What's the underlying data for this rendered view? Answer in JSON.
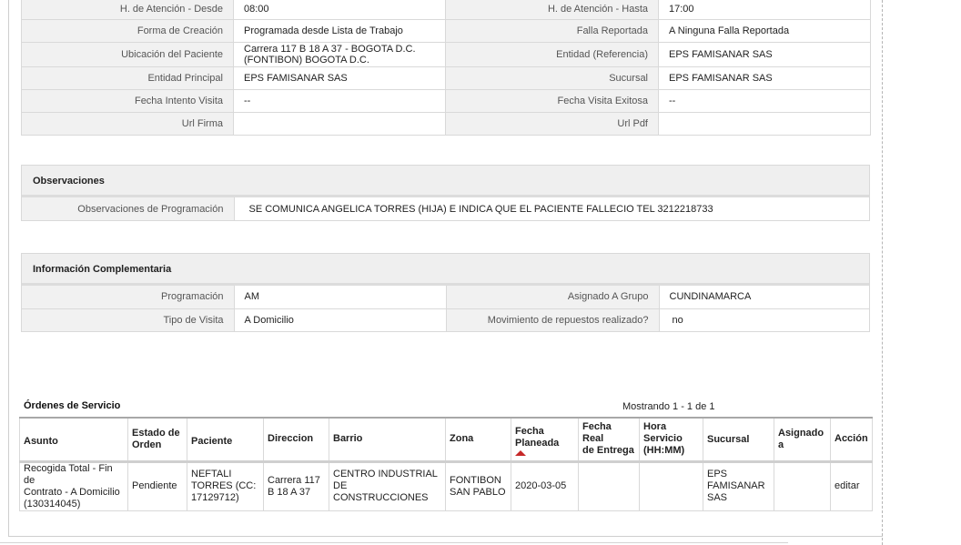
{
  "detail": {
    "rows": [
      {
        "l1": "H. de Atención - Desde",
        "v1": "08:00",
        "l2": "H. de Atención - Hasta",
        "v2": "17:00"
      },
      {
        "l1": "Forma de Creación",
        "v1": "Programada desde Lista de Trabajo",
        "l2": "Falla Reportada",
        "v2": "A Ninguna Falla Reportada"
      },
      {
        "l1": "Ubicación del Paciente",
        "v1a": "Carrera 117 B 18 A 37 - BOGOTA D.C.",
        "v1b": "(FONTIBON) BOGOTA D.C.",
        "l2": "Entidad (Referencia)",
        "v2": "EPS FAMISANAR SAS"
      },
      {
        "l1": "Entidad Principal",
        "v1": "EPS FAMISANAR SAS",
        "l2": "Sucursal",
        "v2": "EPS FAMISANAR SAS"
      },
      {
        "l1": "Fecha Intento Visita",
        "v1": "--",
        "l2": "Fecha Visita Exitosa",
        "v2": "--"
      },
      {
        "l1": "Url Firma",
        "v1": "",
        "l2": "Url Pdf",
        "v2": ""
      }
    ]
  },
  "observaciones": {
    "title": "Observaciones",
    "label": "Observaciones de Programación",
    "value": "SE COMUNICA ANGELICA TORRES (HIJA) E INDICA QUE EL PACIENTE FALLECIO TEL 3212218733"
  },
  "complementaria": {
    "title": "Información Complementaria",
    "rows": [
      {
        "l1": "Programación",
        "v1": "AM",
        "l2": "Asignado A Grupo",
        "v2": "CUNDINAMARCA"
      },
      {
        "l1": "Tipo de Visita",
        "v1": "A Domicilio",
        "l2": "Movimiento de repuestos realizado?",
        "v2": "no"
      }
    ]
  },
  "orders": {
    "title": "Órdenes de Servicio",
    "count": "Mostrando 1 - 1 de 1",
    "headers": {
      "asunto": "Asunto",
      "estado_a": "Estado de",
      "estado_b": "Orden",
      "paciente": "Paciente",
      "direccion": "Direccion",
      "barrio": "Barrio",
      "zona": "Zona",
      "fecha_plan_a": "Fecha",
      "fecha_plan_b": "Planeada",
      "fecha_real_a": "Fecha Real",
      "fecha_real_b": "de Entrega",
      "hora_a": "Hora",
      "hora_b": "Servicio",
      "hora_c": "(HH:MM)",
      "sucursal": "Sucursal",
      "asignado_a": "Asignado",
      "asignado_b": "a",
      "accion": "Acción"
    },
    "row": {
      "asunto_a": "Recogida Total - Fin de",
      "asunto_b": "Contrato - A Domicilio",
      "asunto_c": "(130314045)",
      "estado": "Pendiente",
      "paciente_a": "NEFTALI",
      "paciente_b": "TORRES (CC:",
      "paciente_c": "17129712)",
      "direccion_a": "Carrera 117",
      "direccion_b": "B 18 A 37",
      "barrio_a": "CENTRO INDUSTRIAL DE",
      "barrio_b": "CONSTRUCCIONES",
      "zona_a": "FONTIBON",
      "zona_b": "SAN PABLO",
      "fecha_plan": "2020-03-05",
      "fecha_real": "",
      "hora": "",
      "sucursal_a": "EPS",
      "sucursal_b": "FAMISANAR",
      "sucursal_c": "SAS",
      "asignado": "",
      "accion": "editar"
    }
  },
  "colors": {
    "label_bg": "#f1f1f1",
    "border": "#d9d9d9",
    "sort_arrow": "#c62828"
  }
}
